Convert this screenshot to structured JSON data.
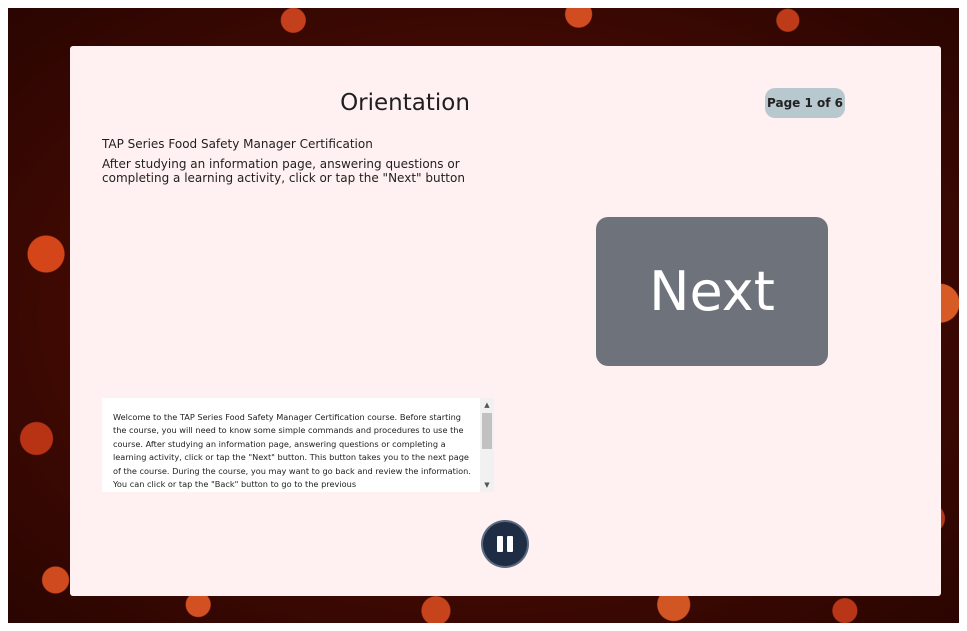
{
  "lesson": {
    "title": "Orientation",
    "page_indicator": "Page 1 of 6",
    "course_name": "TAP Series Food Safety Manager Certification",
    "instructions": "After studying an information page, answering questions or completing a learning activity, click or tap the \"Next\" button"
  },
  "next_button": {
    "label": "Next"
  },
  "transcript": {
    "text": "Welcome to the TAP Series Food Safety Manager Certification course. Before starting the course, you will need to know some simple commands and procedures to use the course. After studying an information page, answering questions or completing a learning activity, click or tap the \"Next\" button. This button takes you to the next page of the course. During the course, you may want to go back and review the information. You can click or tap the \"Back\" button to go to the previous"
  },
  "scroll_arrows": {
    "up": "▲",
    "down": "▼"
  },
  "icons": {
    "pause": "pause-icon"
  },
  "colors": {
    "panel_background": "#fff1f1",
    "next_button": "#6e737b",
    "page_badge": "#b7c8ce",
    "pause_button": "#1f2d44"
  }
}
